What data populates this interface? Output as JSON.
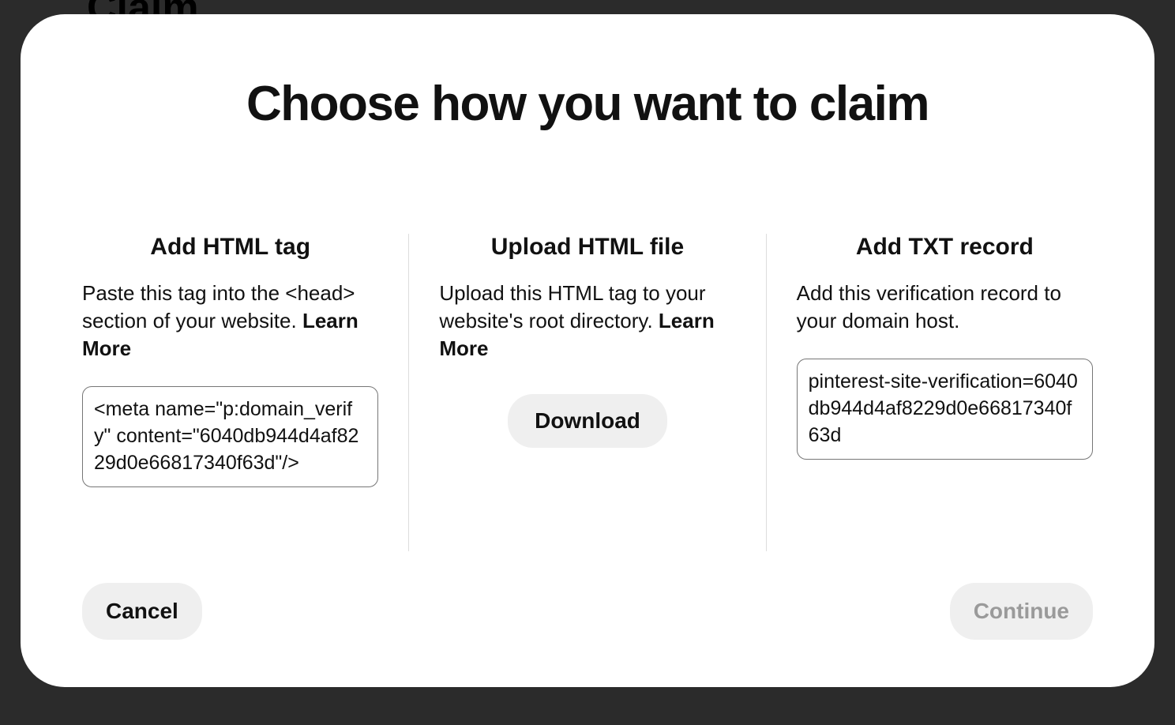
{
  "background": {
    "partial_title": "Claim"
  },
  "modal": {
    "title": "Choose how you want to claim",
    "options": {
      "html_tag": {
        "title": "Add HTML tag",
        "description": "Paste this tag into the <head> section of your website.",
        "learn_more": "Learn More",
        "code": "<meta name=\"p:domain_verify\" content=\"6040db944d4af8229d0e66817340f63d\"/>"
      },
      "html_file": {
        "title": "Upload HTML file",
        "description": "Upload this HTML tag to your website's root directory.",
        "learn_more": "Learn More",
        "download_label": "Download"
      },
      "txt_record": {
        "title": "Add TXT record",
        "description": "Add this verification record to your domain host.",
        "code": "pinterest-site-verification=6040db944d4af8229d0e66817340f63d"
      }
    },
    "buttons": {
      "cancel": "Cancel",
      "continue": "Continue"
    }
  }
}
